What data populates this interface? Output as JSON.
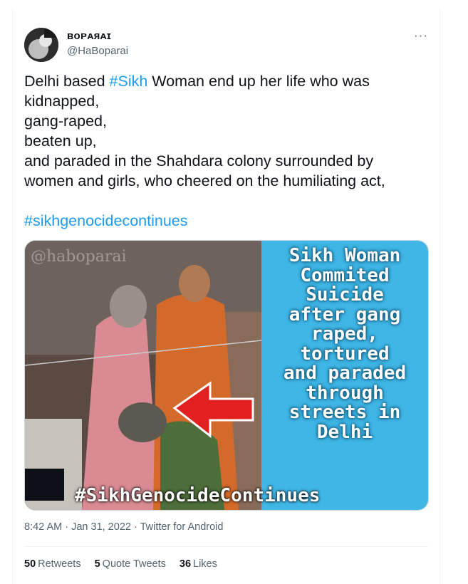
{
  "author": {
    "display_name": "ʙᴏᴘᴀяᴀɪ",
    "handle": "@HaBoparai"
  },
  "more_label": "···",
  "tweet": {
    "line1_pre": "Delhi based ",
    "line1_tag": "#Sikh",
    "line1_post": " Woman end up her life who was",
    "line2": "kidnapped,",
    "line3": "gang-raped,",
    "line4": "beaten up,",
    "line5": "and paraded in the Shahdara colony surrounded by",
    "line6": "women and girls, who cheered on the humiliating act,",
    "hashtag": "#sikhgenocidecontinues"
  },
  "media": {
    "watermark": "@haboparai",
    "overlay_lines": [
      "Sikh Woman",
      "Commited",
      "Suicide",
      "after gang",
      "raped,",
      "tortured",
      "and paraded",
      "through",
      "streets in",
      "Delhi"
    ],
    "bottom_tag": "#SikhGenocideContinues"
  },
  "meta": {
    "time": "8:42 AM",
    "sep1": " · ",
    "date": "Jan 31, 2022",
    "sep2": " · ",
    "source": "Twitter for Android"
  },
  "stats": {
    "retweets_count": "50",
    "retweets_label": "Retweets",
    "quotes_count": "5",
    "quotes_label": "Quote Tweets",
    "likes_count": "36",
    "likes_label": "Likes"
  },
  "colors": {
    "link": "#1d9bf0",
    "secondary_text": "#536471",
    "panel_blue": "#3fb6e6",
    "arrow_red": "#e32020"
  }
}
